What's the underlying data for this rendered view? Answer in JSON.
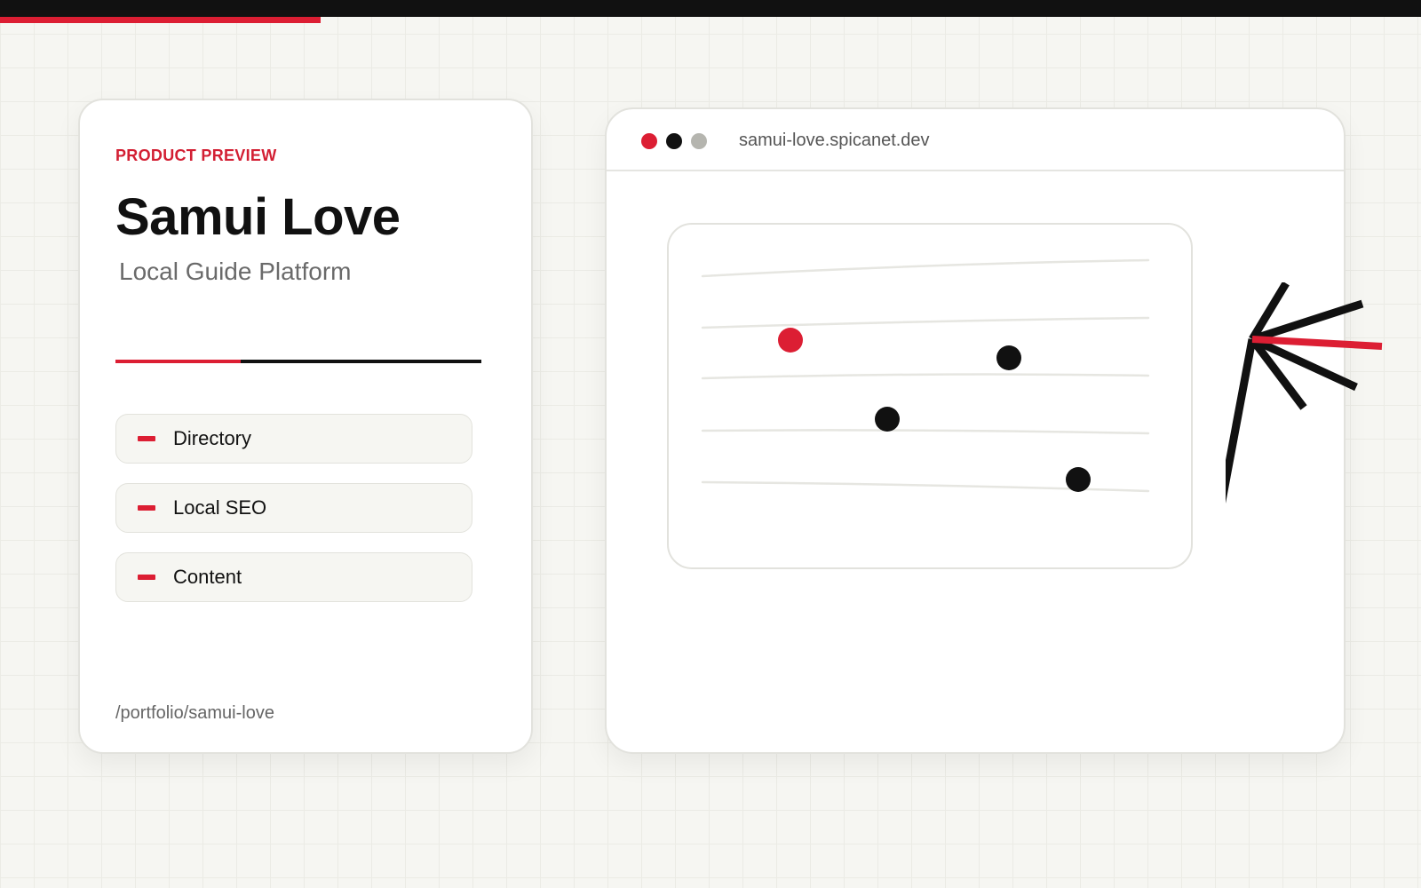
{
  "card": {
    "eyebrow": "PRODUCT PREVIEW",
    "title": "Samui Love",
    "subtitle": "Local Guide Platform",
    "features": [
      {
        "label": "Directory"
      },
      {
        "label": "Local SEO"
      },
      {
        "label": "Content"
      }
    ],
    "path": "/portfolio/samui-love"
  },
  "browser": {
    "url": "samui-love.spicanet.dev"
  },
  "colors": {
    "accent": "#dc1e33",
    "ink": "#111111",
    "muted_dot": "#b5b5af"
  },
  "icons": {
    "doodle": "arrow-burst-doodle-icon"
  }
}
